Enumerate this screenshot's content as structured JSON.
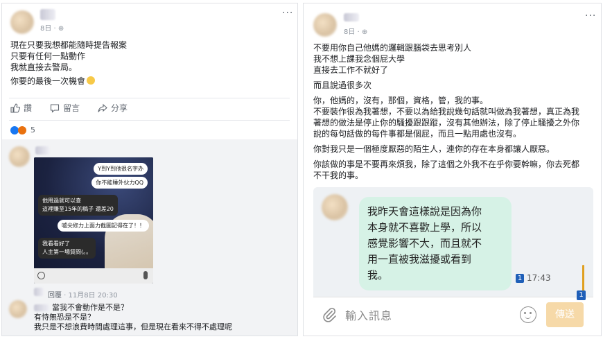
{
  "left_post": {
    "date": "8日",
    "more": "···",
    "lines": [
      "現在只要我想都能隨時提告報案",
      "只要有任何一點動作",
      "我就直接去警局。"
    ],
    "last_line": "你要的最後一次機會",
    "actions": {
      "like": "讚",
      "comment": "留言",
      "share": "分享"
    },
    "reaction_count": "5"
  },
  "chat_screenshot": {
    "bubbles": [
      "Y到Y到他很名字办",
      "你不能睡外伙力QQ",
      "他用過就可以查",
      "這裡賺至15年的稿子 還差20",
      "噓尖修力上面力截圖記得在了！！",
      "我看看好了",
      "人主第一場質問(。。"
    ]
  },
  "comments": {
    "reply": "回覆",
    "reply_time": "11月8日 20:30",
    "lines": [
      "當我不會動作是不是？",
      "有恃無恐是不是？",
      "我只是不想浪費時間處理這事，但是現在看來不得不處理呢"
    ]
  },
  "right_post": {
    "date": "8日",
    "more": "···",
    "paragraphs": [
      [
        "不要用你自己他媽的邏輯跟腦袋去思考別人",
        "我不想上課我念個屁大學",
        "直接去工作不就好了"
      ],
      [
        "而且說過很多次"
      ],
      [
        "你，他媽的，沒有，那個，資格，管，我的事。",
        "不要裝作很為我著想，不要以為給我說幾句話就叫做為我著想，真正為我",
        "著想的做法是停止你的騷擾跟跟蹤，沒有其他辦法，除了停止騷擾之外你",
        "說的每句話做的每件事都是個屁，而且一點用處也沒有。"
      ],
      [
        "你對我只是一個極度厭惡的陌生人，連你的存在本身都讓人厭惡。"
      ],
      [
        "你該做的事是不要再來煩我，除了這個之外我不在乎你要幹嘛，你去死都",
        "不干我的事。"
      ]
    ]
  },
  "line_chat": {
    "bubble_lines": [
      "我昨天會這樣說是因為你",
      "本身就不喜歡上學，所以",
      "感覺影響不大，而且就不",
      "用一直被我滋擾或看到",
      "我。"
    ],
    "read_count": "1",
    "time": "17:43",
    "input_placeholder": "輸入訊息",
    "send_label": "傳送",
    "send_badge": "1"
  }
}
